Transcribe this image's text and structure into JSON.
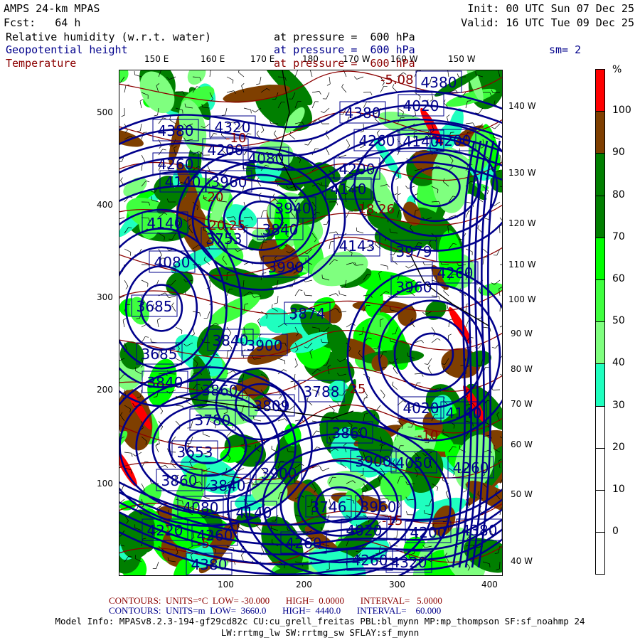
{
  "header": {
    "model": "AMPS 24-km MPAS",
    "init": "Init: 00 UTC Sun 07 Dec 25",
    "fcst": "Fcst:   64 h",
    "valid": "Valid: 16 UTC Tue 09 Dec 25",
    "fields": [
      {
        "name": "Relative humidity (w.r.t. water)",
        "level": "at pressure =  600 hPa",
        "color": "#000000"
      },
      {
        "name": "Geopotential height",
        "level": "at pressure =  600 hPa",
        "color": "#00008b"
      },
      {
        "name": "Temperature",
        "level": "at pressure =  600 hPa",
        "color": "#8b0000"
      }
    ],
    "smoothing": "sm= 2"
  },
  "axes": {
    "top_lon": [
      "150 E",
      "160 E",
      "170 E",
      "180",
      "170 W",
      "160 W",
      "150 W"
    ],
    "right_lon": [
      "140 W",
      "130 W",
      "120 W",
      "110 W",
      "100 W",
      "90 W",
      "80 W",
      "70 W",
      "60 W",
      "50 W",
      "40 W"
    ],
    "left_y": [
      "500",
      "400",
      "300",
      "200",
      "100"
    ],
    "bottom_x": [
      "100",
      "200",
      "300",
      "400"
    ]
  },
  "colorbar": {
    "unit": "%",
    "labels": [
      "100",
      "90",
      "80",
      "70",
      "60",
      "50",
      "40",
      "30",
      "20",
      "10",
      "0"
    ],
    "colors": [
      "#ff0000",
      "#7f3f00",
      "#007f00",
      "#007f00",
      "#00ff00",
      "#3fff3f",
      "#7fff7f",
      "#1fffbf",
      "#ffffff",
      "#ffffff",
      "#ffffff",
      "#ffffff"
    ]
  },
  "height_labels": [
    "4380",
    "4380",
    "4020",
    "4380",
    "4320",
    "4200",
    "4260",
    "4080",
    "4260",
    "4140",
    "4200",
    "4200",
    "4140",
    "3960",
    "4140",
    "3940",
    "4140",
    "3840",
    "3753",
    "4143",
    "3979",
    "4080",
    "4260",
    "3990",
    "3960",
    "3685",
    "3874",
    "3840",
    "3900",
    "3685",
    "3840",
    "3860",
    "3809",
    "3788",
    "4020",
    "4140",
    "3780",
    "3860",
    "3653",
    "3900",
    "4050",
    "4260",
    "3900",
    "3860",
    "3840",
    "3960",
    "4080",
    "4140",
    "3746",
    "4020",
    "4200",
    "4220",
    "4260",
    "4260",
    "4380",
    "4260",
    "4320",
    "4380"
  ],
  "temp_labels": [
    "-5.08",
    "-10",
    "-18.26",
    "-20.25",
    "-25",
    "-20",
    "-5",
    "-15",
    "-10"
  ],
  "footer": {
    "temp_contours": "CONTOURS:  UNITS=°C  LOW= -30.000       HIGH=  0.0000       INTERVAL=   5.0000",
    "height_contours": "CONTOURS:  UNITS=m  LOW=  3660.0       HIGH=  4440.0       INTERVAL=    60.000",
    "model_info": "Model Info: MPASv8.2.3-194-gf29cd82c CU:cu_grell_freitas PBL:bl_mynn MP:mp_thompson SF:sf_noahmp 24",
    "model_info2": "LW:rrtmg_lw SW:rrtmg_sw SFLAY:sf_mynn"
  }
}
